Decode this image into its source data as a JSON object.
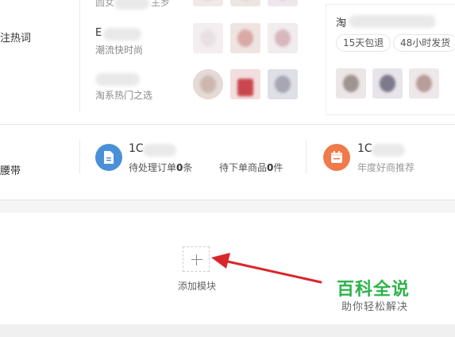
{
  "top_section": {
    "left_label": "注热词",
    "rows": [
      {
        "title": "圆女",
        "title_tail": "主罗",
        "subtitle": ""
      },
      {
        "title": "E",
        "subtitle": "潮流快时尚"
      },
      {
        "title": "",
        "subtitle": "淘系热门之选"
      }
    ],
    "right_card": {
      "title": "淘",
      "tags": [
        "15天包退",
        "48小时发货"
      ]
    }
  },
  "stats_section": {
    "left_label": "腰带",
    "stat_1": {
      "number": "1C",
      "line_prefix": "待处理订单",
      "line_value": "0",
      "line_suffix": "条"
    },
    "stat_2": {
      "line_prefix": "待下单商品",
      "line_value": "0",
      "line_suffix": "件"
    },
    "stat_3": {
      "number": "1C",
      "subtitle": "年度好商推荐"
    },
    "colors": {
      "blue_icon": "#4a90d9",
      "orange_icon": "#f07a4a"
    }
  },
  "add_module": {
    "icon": "plus-icon",
    "label": "添加模块"
  },
  "watermark": {
    "title": "百科全说",
    "subtitle": "助你轻松解决",
    "color": "#2db34a"
  },
  "annotation": {
    "arrow_color": "#d9262b"
  }
}
